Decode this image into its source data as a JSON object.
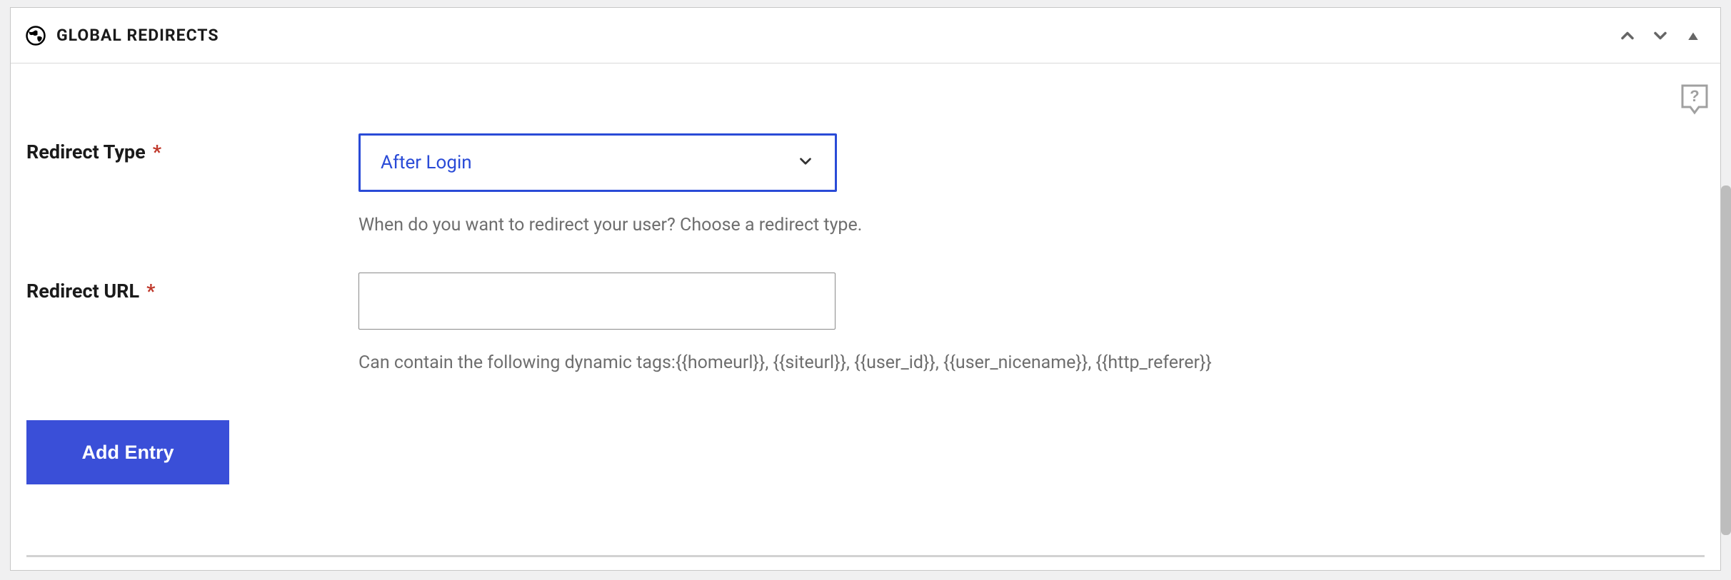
{
  "panel": {
    "title": "GLOBAL REDIRECTS"
  },
  "form": {
    "redirect_type": {
      "label": "Redirect Type",
      "value": "After Login",
      "help": "When do you want to redirect your user? Choose a redirect type."
    },
    "redirect_url": {
      "label": "Redirect URL",
      "value": "",
      "help": "Can contain the following dynamic tags:{{homeurl}}, {{siteurl}}, {{user_id}}, {{user_nicename}}, {{http_referer}}"
    }
  },
  "actions": {
    "add_entry": "Add Entry"
  }
}
